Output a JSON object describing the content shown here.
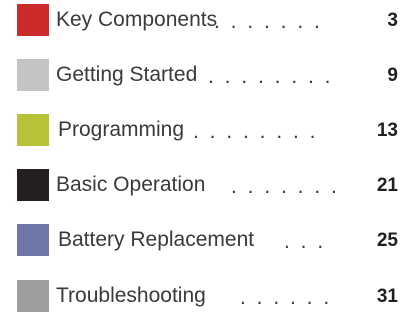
{
  "toc": {
    "entries": [
      {
        "title": "Key Components",
        "leader": ". . . . . . .",
        "page": "3",
        "color": "#cc2b2b"
      },
      {
        "title": "Getting Started",
        "leader": ". . . . . . . .",
        "page": "9",
        "color": "#c4c4c4"
      },
      {
        "title": "Programming",
        "leader": ". . . . . . . .",
        "page": "13",
        "color": "#b7c238"
      },
      {
        "title": "Basic Operation",
        "leader": ". . . . . . .",
        "page": "21",
        "color": "#231f20"
      },
      {
        "title": "Battery Replacement",
        "leader": ". . .",
        "page": "25",
        "color": "#6e77a8"
      },
      {
        "title": "Troubleshooting",
        "leader": ". . . . . .",
        "page": "31",
        "color": "#9d9d9d"
      }
    ]
  }
}
